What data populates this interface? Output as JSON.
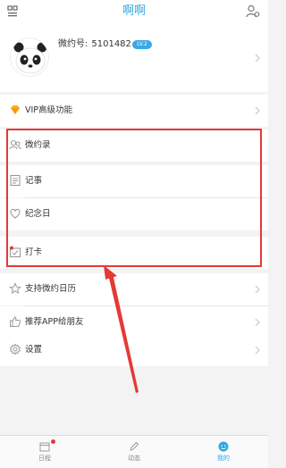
{
  "header": {
    "title": "啊啊",
    "left_icon": "qr-grid-icon",
    "right_icon": "user-settings-icon",
    "accent": "#2ea7e0"
  },
  "profile": {
    "avatar_icon": "panda-avatar",
    "id_label": "微约号:",
    "id_value": "5101482",
    "level": "LV.2"
  },
  "menu": [
    {
      "label": "VIP高级功能",
      "icon": "diamond-icon"
    },
    {
      "label": "微约录",
      "icon": "contacts-icon"
    },
    {
      "label": "记事",
      "icon": "note-icon"
    },
    {
      "label": "纪念日",
      "icon": "heart-icon"
    },
    {
      "label": "打卡",
      "icon": "checkin-icon"
    },
    {
      "label": "支持微约日历",
      "icon": "star-icon"
    },
    {
      "label": "推荐APP给朋友",
      "icon": "thumbs-up-icon"
    },
    {
      "label": "设置",
      "icon": "gear-icon"
    }
  ],
  "tabs": [
    {
      "label": "日程",
      "icon": "calendar-icon",
      "active": false,
      "badge": true
    },
    {
      "label": "动态",
      "icon": "pencil-icon",
      "active": false,
      "badge": false
    },
    {
      "label": "我的",
      "icon": "smile-icon",
      "active": true,
      "badge": false
    }
  ],
  "annotation_color": "#e53935"
}
